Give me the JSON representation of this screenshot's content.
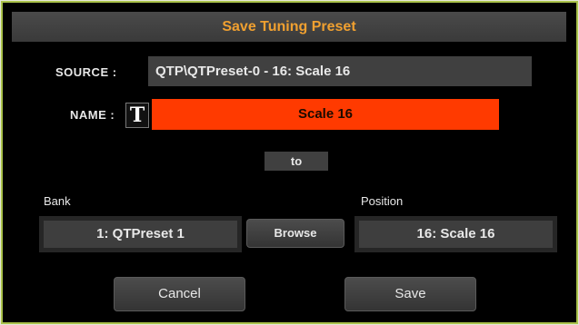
{
  "dialog": {
    "title": "Save Tuning Preset"
  },
  "source": {
    "label": "SOURCE :",
    "value": "QTP\\QTPreset-0 - 16: Scale 16"
  },
  "name": {
    "label": "NAME :",
    "text_icon_glyph": "T",
    "value": "Scale 16"
  },
  "to_label": "to",
  "bank": {
    "label": "Bank",
    "value": "1: QTPreset 1"
  },
  "browse_label": "Browse",
  "position": {
    "label": "Position",
    "value": "16: Scale 16"
  },
  "buttons": {
    "cancel": "Cancel",
    "save": "Save"
  },
  "colors": {
    "title_text": "#f0a030",
    "name_field": "#ff3a00",
    "dialog_border": "#aac24a"
  }
}
